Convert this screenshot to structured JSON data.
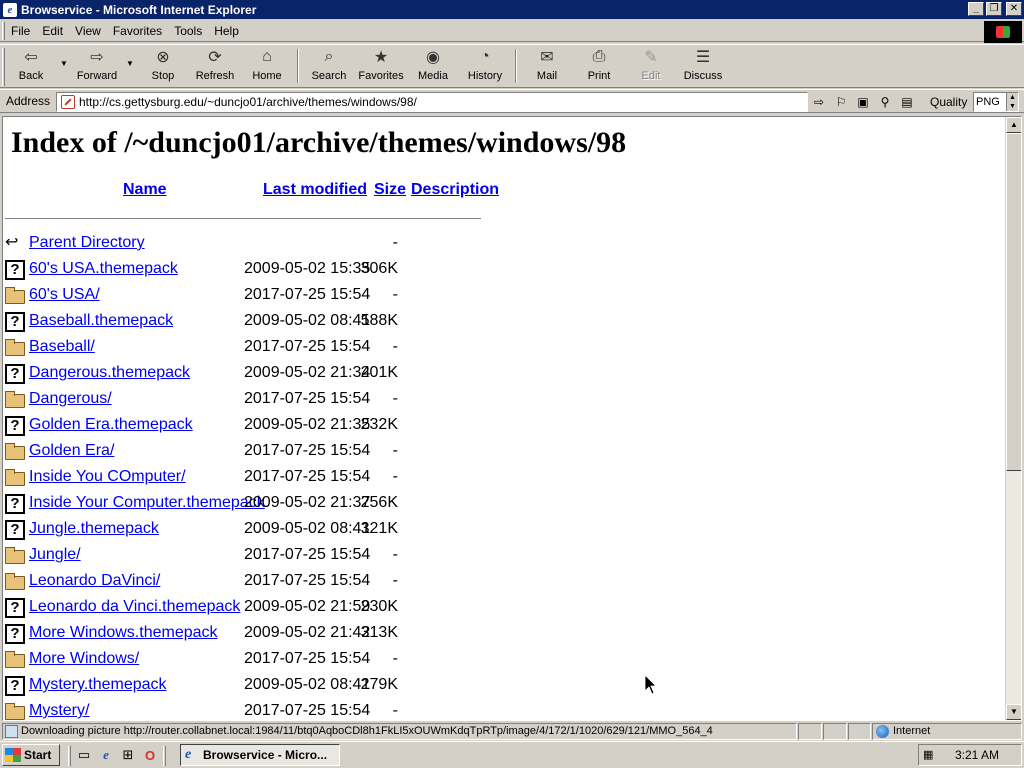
{
  "window": {
    "title": "Browservice - Microsoft Internet Explorer",
    "controls": [
      "_",
      "❐",
      "✕"
    ]
  },
  "menu": [
    "File",
    "Edit",
    "View",
    "Favorites",
    "Tools",
    "Help"
  ],
  "toolbar": {
    "back": "Back",
    "forward": "Forward",
    "stop": "Stop",
    "refresh": "Refresh",
    "home": "Home",
    "search": "Search",
    "favorites": "Favorites",
    "media": "Media",
    "history": "History",
    "mail": "Mail",
    "print": "Print",
    "edit": "Edit",
    "discuss": "Discuss"
  },
  "address": {
    "label": "Address",
    "url": "http://cs.gettysburg.edu/~duncjo01/archive/themes/windows/98/",
    "quality_label": "Quality",
    "quality_value": "PNG"
  },
  "page": {
    "heading": "Index of /~duncjo01/archive/themes/windows/98",
    "columns": {
      "name": "Name",
      "modified": "Last modified",
      "size": "Size",
      "description": "Description"
    },
    "entries": [
      {
        "icon": "back",
        "name": "Parent Directory",
        "date": "",
        "size": "-"
      },
      {
        "icon": "file",
        "name": "60's USA.themepack",
        "date": "2009-05-02 15:35",
        "size": "306K"
      },
      {
        "icon": "folder",
        "name": "60's USA/",
        "date": "2017-07-25 15:54",
        "size": "-"
      },
      {
        "icon": "file",
        "name": "Baseball.themepack",
        "date": "2009-05-02 08:41",
        "size": "588K"
      },
      {
        "icon": "folder",
        "name": "Baseball/",
        "date": "2017-07-25 15:54",
        "size": "-"
      },
      {
        "icon": "file",
        "name": "Dangerous.themepack",
        "date": "2009-05-02 21:34",
        "size": "201K"
      },
      {
        "icon": "folder",
        "name": "Dangerous/",
        "date": "2017-07-25 15:54",
        "size": "-"
      },
      {
        "icon": "file",
        "name": "Golden Era.themepack",
        "date": "2009-05-02 21:35",
        "size": "232K"
      },
      {
        "icon": "folder",
        "name": "Golden Era/",
        "date": "2017-07-25 15:54",
        "size": "-"
      },
      {
        "icon": "folder",
        "name": "Inside You COmputer/",
        "date": "2017-07-25 15:54",
        "size": "-"
      },
      {
        "icon": "file",
        "name": "Inside Your Computer.themepack",
        "date": "2009-05-02 21:37",
        "size": "256K"
      },
      {
        "icon": "file",
        "name": "Jungle.themepack",
        "date": "2009-05-02 08:41",
        "size": "321K"
      },
      {
        "icon": "folder",
        "name": "Jungle/",
        "date": "2017-07-25 15:54",
        "size": "-"
      },
      {
        "icon": "folder",
        "name": "Leonardo DaVinci/",
        "date": "2017-07-25 15:54",
        "size": "-"
      },
      {
        "icon": "file",
        "name": "Leonardo da Vinci.themepack",
        "date": "2009-05-02 21:59",
        "size": "230K"
      },
      {
        "icon": "file",
        "name": "More Windows.themepack",
        "date": "2009-05-02 21:42",
        "size": "313K"
      },
      {
        "icon": "folder",
        "name": "More Windows/",
        "date": "2017-07-25 15:54",
        "size": "-"
      },
      {
        "icon": "file",
        "name": "Mystery.themepack",
        "date": "2009-05-02 08:41",
        "size": "279K"
      },
      {
        "icon": "folder",
        "name": "Mystery/",
        "date": "2017-07-25 15:54",
        "size": "-"
      }
    ]
  },
  "status": {
    "text": "Downloading picture http://router.collabnet.local:1984/11/btq0AqboCDl8h1FkLI5xOUWmKdqTpRTp/image/4/172/1/1020/629/121/MMO_564_4",
    "zone": "Internet"
  },
  "taskbar": {
    "start": "Start",
    "task": "Browservice - Micro...",
    "clock": "3:21 AM"
  }
}
